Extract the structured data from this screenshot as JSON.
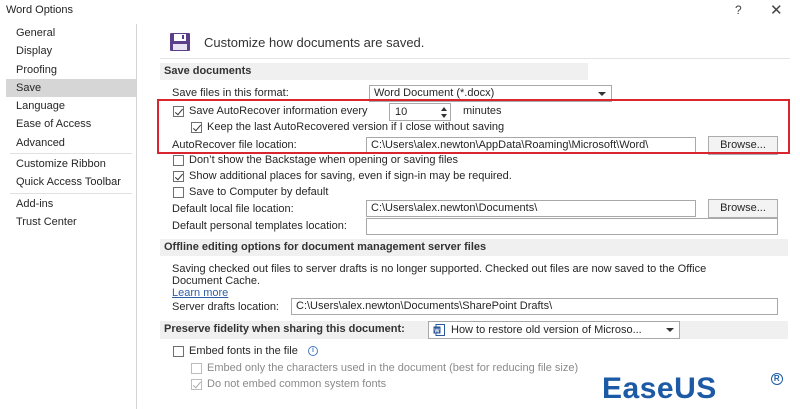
{
  "window": {
    "title": "Word Options",
    "help": "?",
    "close": "✕"
  },
  "sidebar": {
    "items": [
      {
        "label": "General"
      },
      {
        "label": "Display"
      },
      {
        "label": "Proofing"
      },
      {
        "label": "Save",
        "active": true
      },
      {
        "label": "Language"
      },
      {
        "label": "Ease of Access"
      },
      {
        "label": "Advanced"
      },
      {
        "label": "Customize Ribbon"
      },
      {
        "label": "Quick Access Toolbar"
      },
      {
        "label": "Add-ins"
      },
      {
        "label": "Trust Center"
      }
    ]
  },
  "header": {
    "text": "Customize how documents are saved."
  },
  "save_documents": {
    "section_title": "Save documents",
    "format_label": "Save files in this format:",
    "format_value": "Word Document (*.docx)",
    "autorecover_label": "Save AutoRecover information every",
    "autorecover_minutes": "10",
    "minutes_label": "minutes",
    "keep_last_label": "Keep the last AutoRecovered version if I close without saving",
    "autorecover_location_label": "AutoRecover file location:",
    "autorecover_location_value": "C:\\Users\\alex.newton\\AppData\\Roaming\\Microsoft\\Word\\",
    "browse_label": "Browse...",
    "backstage_label": "Don’t show the Backstage when opening or saving files",
    "additional_places_label": "Show additional places for saving, even if sign-in may be required.",
    "save_to_computer_label": "Save to Computer by default",
    "default_local_label": "Default local file location:",
    "default_local_value": "C:\\Users\\alex.newton\\Documents\\",
    "browse2_label": "Browse...",
    "default_templates_label": "Default personal templates location:",
    "default_templates_value": ""
  },
  "offline": {
    "section_title": "Offline editing options for document management server files",
    "notice_line1": "Saving checked out files to server drafts is no longer supported. Checked out files are now saved to the Office",
    "notice_line2": "Document Cache.",
    "learn_more": "Learn more",
    "server_drafts_label": "Server drafts location:",
    "server_drafts_value": "C:\\Users\\alex.newton\\Documents\\SharePoint Drafts\\"
  },
  "fidelity": {
    "section_title": "Preserve fidelity when sharing this document:",
    "document_value": "How to restore old version of Microso...",
    "embed_fonts_label": "Embed fonts in the file",
    "embed_only_label": "Embed only the characters used in the document (best for reducing file size)",
    "do_not_embed_label": "Do not embed common system fonts"
  },
  "watermark": {
    "text": "EaseUS",
    "reg": "R"
  }
}
